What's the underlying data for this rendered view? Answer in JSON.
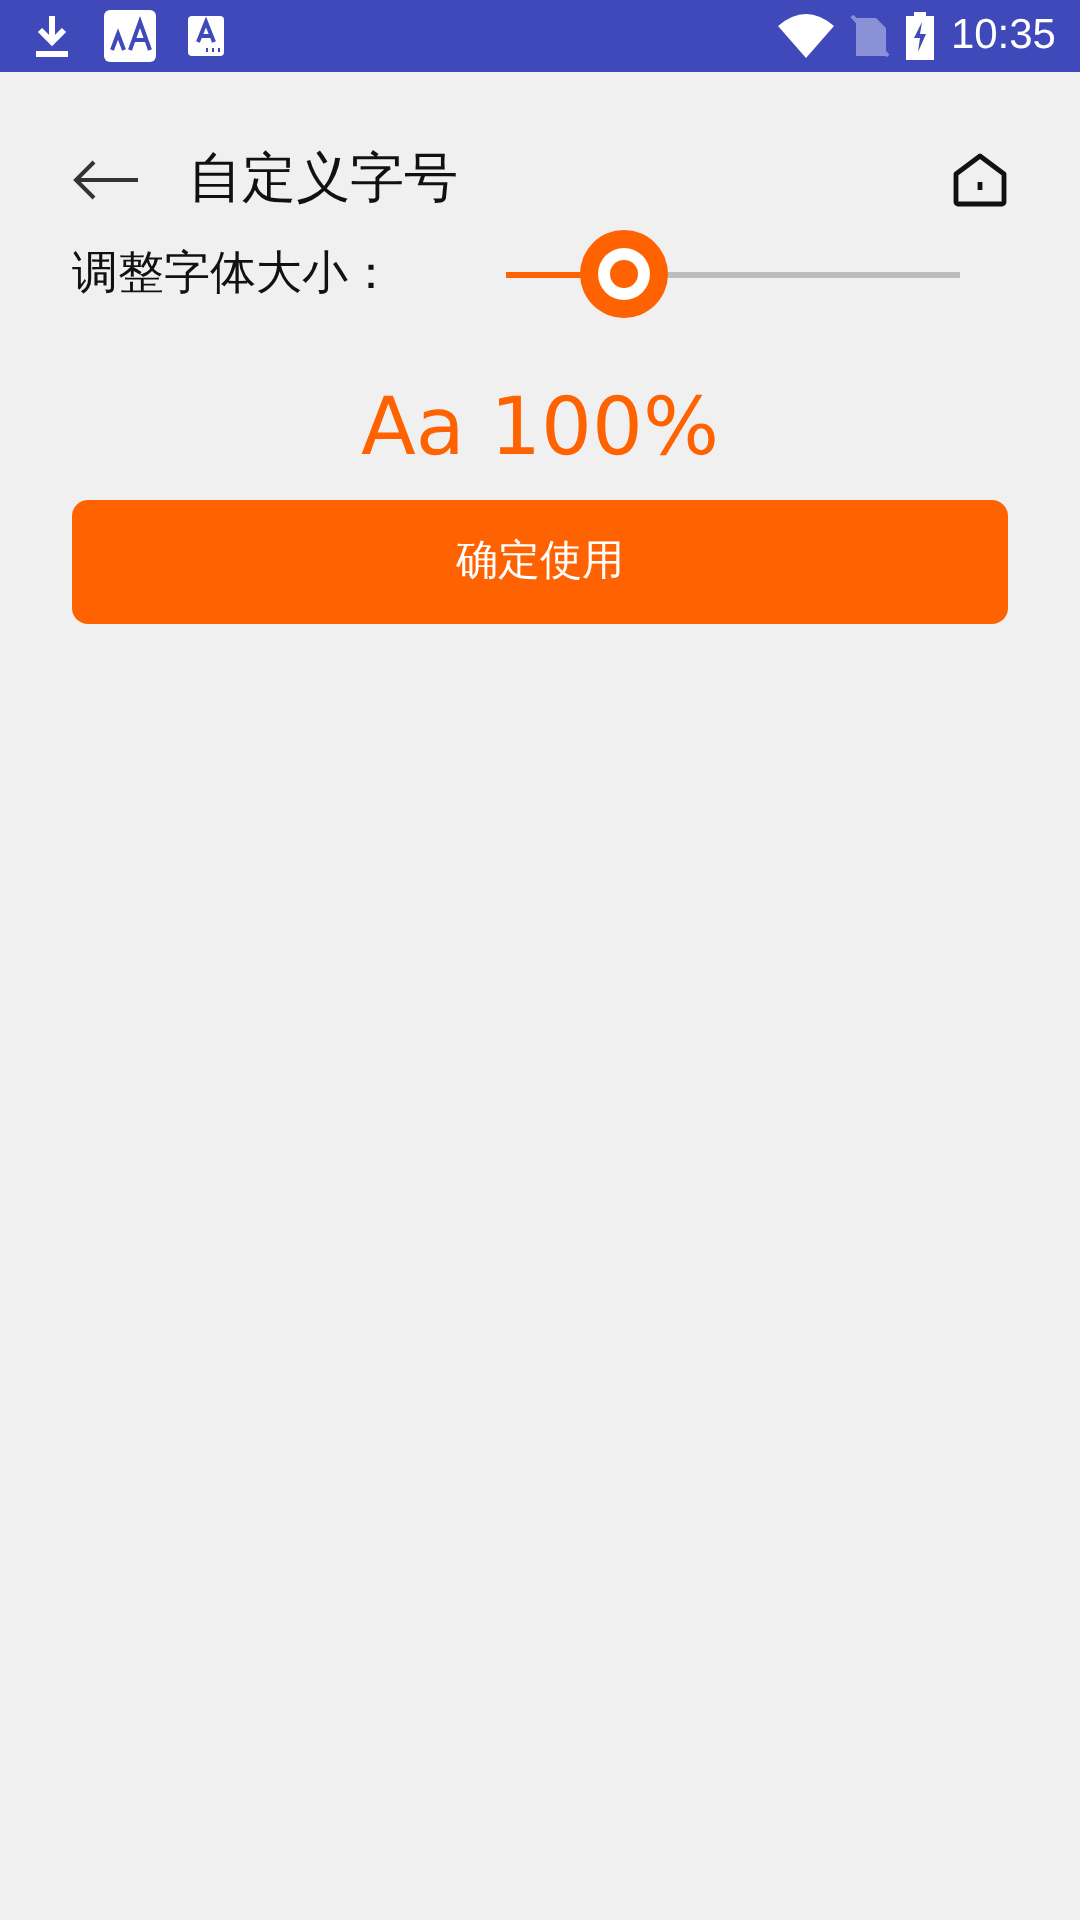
{
  "status_bar": {
    "time": "10:35"
  },
  "header": {
    "title": "自定义字号"
  },
  "font_size": {
    "label": "调整字体大小：",
    "level": 0.26,
    "preview": "Aa 100%"
  },
  "confirm_button": {
    "label": "确定使用"
  }
}
